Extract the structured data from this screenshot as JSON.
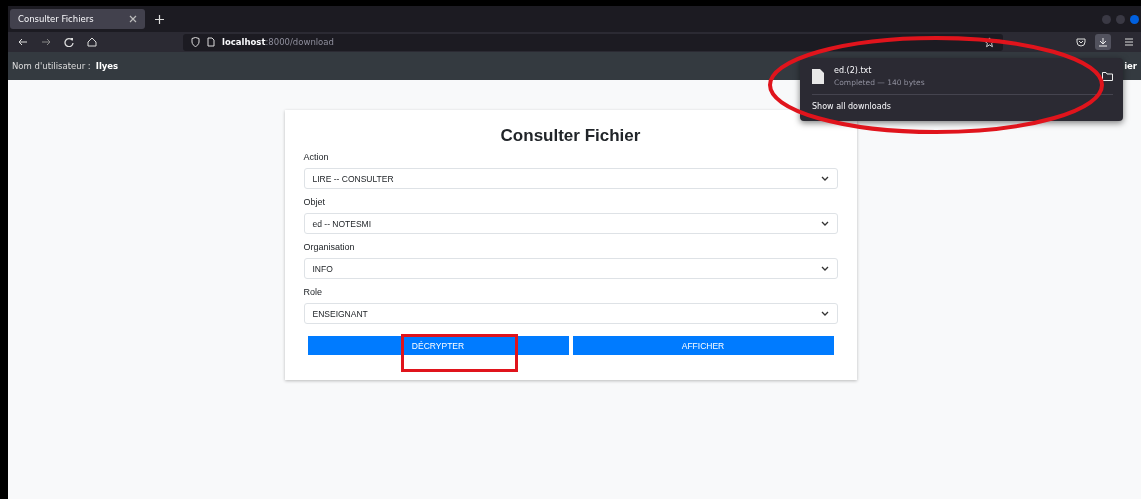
{
  "tabs": [
    {
      "title": "Consulter Fichiers",
      "selected": true
    }
  ],
  "address": {
    "host": "localhost",
    "rest": ":8000/download"
  },
  "header": {
    "user_label": "Nom d'utilisateur :",
    "user_name": "Ilyes",
    "right_text": "ier"
  },
  "downloads_panel": {
    "file_name": "ed.(2).txt",
    "status": "Completed — 140 bytes",
    "show_all": "Show all downloads"
  },
  "form": {
    "title": "Consulter Fichier",
    "fields": [
      {
        "label": "Action",
        "value": "LIRE -- CONSULTER"
      },
      {
        "label": "Objet",
        "value": "ed -- NOTESMI"
      },
      {
        "label": "Organisation",
        "value": "INFO"
      },
      {
        "label": "Role",
        "value": "ENSEIGNANT"
      }
    ],
    "buttons": [
      "DÉCRYPTER",
      "AFFICHER"
    ]
  }
}
